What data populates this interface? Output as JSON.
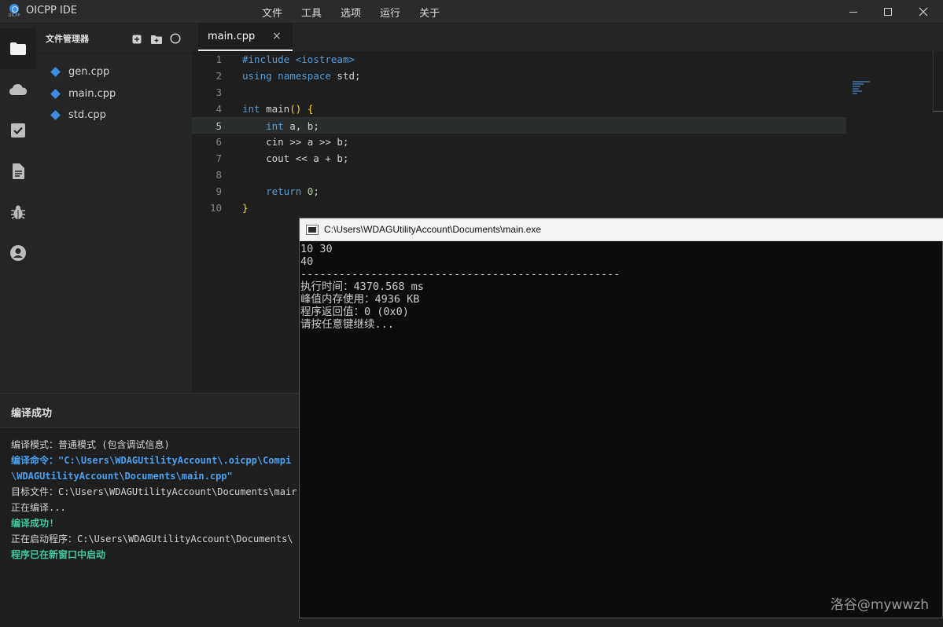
{
  "titlebar": {
    "app_title": "OICPP IDE",
    "logo_caption": "OICPP",
    "menu": [
      "文件",
      "工具",
      "选项",
      "运行",
      "关于"
    ]
  },
  "activity_icons": [
    "folder-icon",
    "cloud-icon",
    "checkbox-icon",
    "document-icon",
    "bug-icon",
    "account-icon"
  ],
  "sidebar": {
    "title": "文件管理器",
    "files": [
      "gen.cpp",
      "main.cpp",
      "std.cpp"
    ]
  },
  "editor": {
    "tab_label": "main.cpp",
    "tab_close": "×",
    "current_line": 5,
    "line_numbers": [
      "1",
      "2",
      "3",
      "4",
      "5",
      "6",
      "7",
      "8",
      "9",
      "10"
    ],
    "code": {
      "l1a": "#include",
      "l1b": " ",
      "l1c": "<iostream>",
      "l2a": "using",
      "l2b": " ",
      "l2c": "namespace",
      "l2d": " std;",
      "l4a": "int",
      "l4b": " ",
      "l4c": "main",
      "l4d": "()",
      "l4e": " ",
      "l4f": "{",
      "l5a": "    ",
      "l5b": "int",
      "l5c": " a, b;",
      "l6": "    cin >> a >> b;",
      "l7": "    cout << a + b;",
      "l9a": "    ",
      "l9b": "return",
      "l9c": " ",
      "l9d": "0",
      "l9e": ";",
      "l10": "}"
    }
  },
  "panel": {
    "title": "编译成功",
    "lines": [
      "编译模式：普通模式 (包含调试信息)",
      "编译命令：\"C:\\Users\\WDAGUtilityAccount\\.oicpp\\Compi",
      "\\WDAGUtilityAccount\\Documents\\main.cpp\"",
      "目标文件：C:\\Users\\WDAGUtilityAccount\\Documents\\mair",
      "正在编译...",
      "编译成功!",
      "正在启动程序：C:\\Users\\WDAGUtilityAccount\\Documents\\",
      "程序已在新窗口中启动"
    ]
  },
  "console": {
    "title": "C:\\Users\\WDAGUtilityAccount\\Documents\\main.exe",
    "lines": [
      "10 30",
      "40",
      "--------------------------------------------------",
      "执行时间：4370.568 ms",
      "峰值内存使用：4936 KB",
      "程序返回值：0 (0x0)",
      "请按任意键继续..."
    ]
  },
  "watermark": "洛谷@mywwzh",
  "colors": {
    "accent": "#3f8de1",
    "keyword": "#569cd6",
    "success": "#3fc9a0",
    "command": "#4aa0f0"
  }
}
